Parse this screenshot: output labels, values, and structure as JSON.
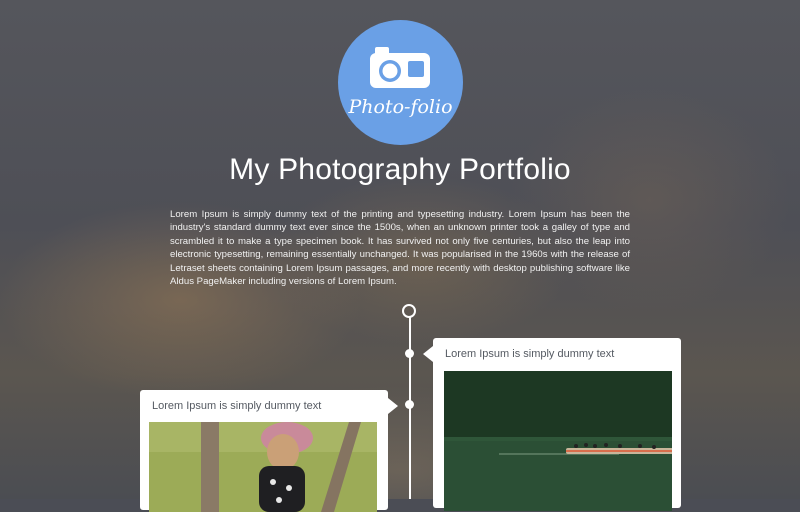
{
  "logo": {
    "text": "Photo-folio",
    "icon": "camera-icon",
    "color": "#6aa0e6"
  },
  "header": {
    "title": "My Photography Portfolio"
  },
  "intro": {
    "text": "Lorem Ipsum is simply dummy text of the printing and typesetting industry. Lorem Ipsum has been the industry's standard dummy text ever since the 1500s, when an unknown printer took a galley of type and scrambled it to make a type specimen book. It has survived not only five centuries, but also the leap into electronic typesetting, remaining essentially unchanged. It was popularised in the 1960s with the release of Letraset sheets containing Lorem Ipsum passages, and more recently with desktop publishing software like Aldus PageMaker including versions of Lorem Ipsum."
  },
  "timeline": {
    "items": [
      {
        "side": "right",
        "title": "Lorem Ipsum is simply dummy text",
        "photo": "birds-on-lake-photo"
      },
      {
        "side": "left",
        "title": "Lorem Ipsum is simply dummy text",
        "photo": "child-in-pink-hat-photo"
      }
    ]
  }
}
